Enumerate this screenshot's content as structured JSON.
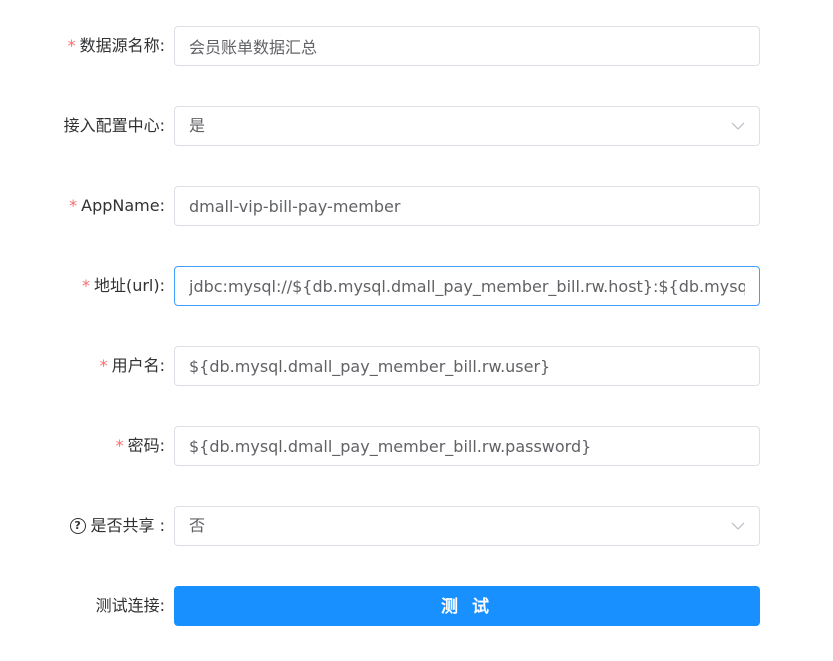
{
  "form": {
    "datasource_name": {
      "required": "*",
      "label": "数据源名称:",
      "value": "会员账单数据汇总"
    },
    "config_center": {
      "label": "接入配置中心:",
      "value": "是"
    },
    "app_name": {
      "required": "*",
      "label": "AppName:",
      "value": "dmall-vip-bill-pay-member"
    },
    "url": {
      "required": "*",
      "label": "地址(url):",
      "value": "jdbc:mysql://${db.mysql.dmall_pay_member_bill.rw.host}:${db.mysql.dmall_pay_member_bill.rw.port}/dmall_pay_member_bill"
    },
    "username": {
      "required": "*",
      "label": "用户名:",
      "value": "${db.mysql.dmall_pay_member_bill.rw.user}"
    },
    "password": {
      "required": "*",
      "label": "密码:",
      "value": "${db.mysql.dmall_pay_member_bill.rw.password}"
    },
    "shared": {
      "help_icon": "?",
      "label": "是否共享 :",
      "value": "否"
    },
    "test_connection": {
      "label": "测试连接:",
      "button_label": "测 试"
    }
  },
  "colors": {
    "required_star": "#f56c6c",
    "primary_button": "#1890ff",
    "focus_border": "#409eff",
    "border": "#dcdfe6"
  },
  "icons": {
    "select_arrow": "chevron-down-icon",
    "help": "question-circle-icon"
  }
}
